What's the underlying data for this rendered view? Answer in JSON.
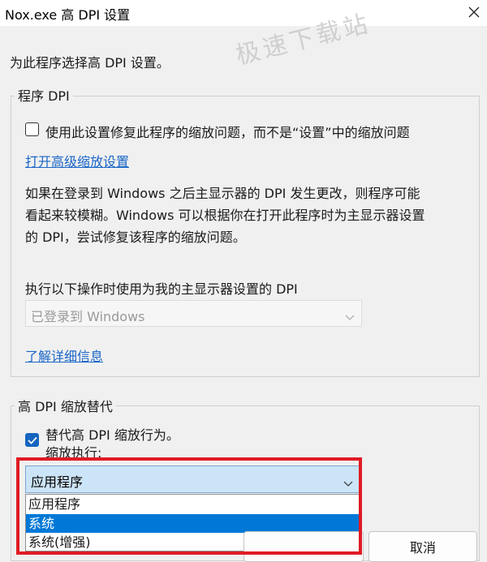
{
  "window": {
    "title": "Nox.exe 高 DPI 设置"
  },
  "watermark": "极速下载站",
  "intro": "为此程序选择高 DPI 设置。",
  "program_dpi": {
    "legend": "程序 DPI",
    "checkbox_label": "使用此设置修复此程序的缩放问题，而不是“设置”中的缩放问题",
    "checkbox_checked": false,
    "link_advanced": "打开高级缩放设置",
    "description_lines": [
      "如果在登录到 Windows 之后主显示器的 DPI 发生更改，则程序可能",
      "看起来较模糊。Windows 可以根据你在打开此程序时为主显示器设置",
      "的 DPI，尝试修复该程序的缩放问题。"
    ],
    "exec_label": "执行以下操作时使用为我的主显示器设置的 DPI",
    "exec_value": "已登录到 Windows",
    "link_learn": "了解详细信息"
  },
  "override": {
    "legend": "高 DPI 缩放替代",
    "checkbox_label": "替代高 DPI 缩放行为。",
    "checkbox_checked": true,
    "sub_label": "缩放执行:",
    "selected_value": "应用程序",
    "options": [
      "应用程序",
      "系统",
      "系统(增强)"
    ],
    "highlighted_option": "系统"
  },
  "buttons": {
    "ok": "",
    "cancel": "取消"
  },
  "colors": {
    "highlight_border": "#e01b24",
    "selection": "#0078d7",
    "link": "#1a66c7",
    "checkbox_checked": "#1565c0"
  }
}
